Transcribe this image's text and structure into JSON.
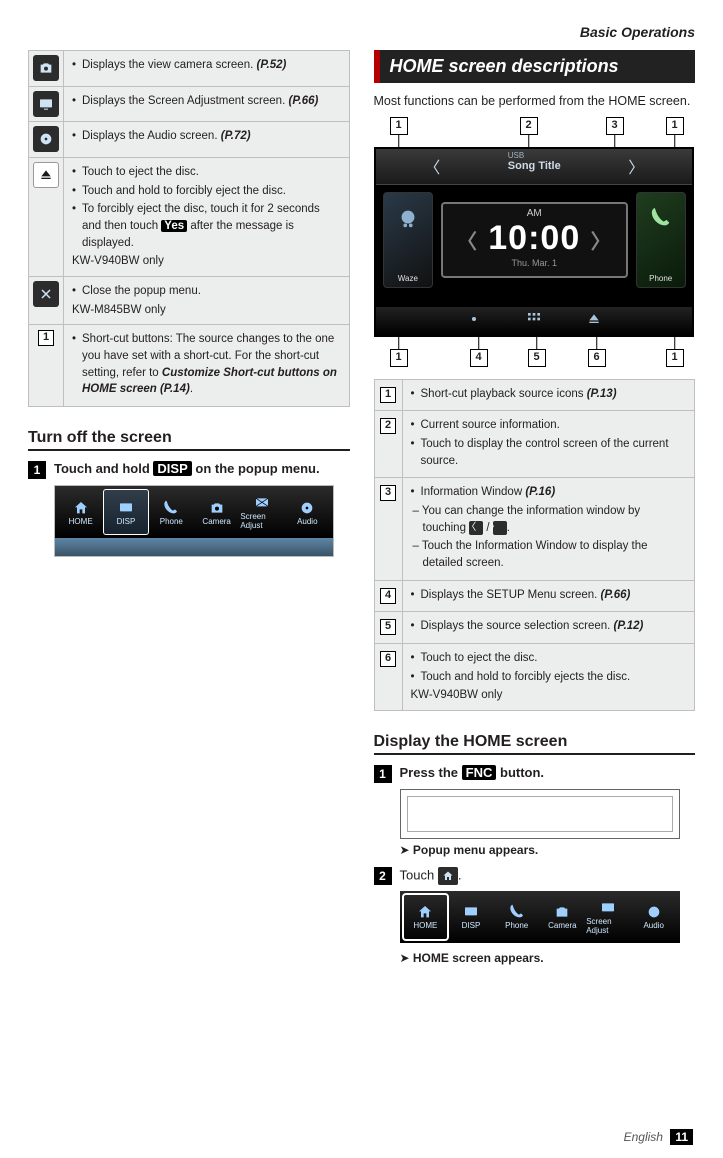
{
  "runningHeader": "Basic Operations",
  "leftTable": {
    "rows": [
      {
        "iconName": "camera-icon",
        "text": "Displays the view camera screen.",
        "ref": "(P.52)"
      },
      {
        "iconName": "screen-adjust-icon",
        "text": "Displays the Screen Adjustment screen.",
        "ref": "(P.66)"
      },
      {
        "iconName": "audio-icon",
        "text": "Displays the Audio screen.",
        "ref": "(P.72)"
      },
      {
        "iconName": "eject-icon",
        "bullets": [
          "Touch to eject the disc.",
          "Touch and hold to forcibly eject the disc.",
          "To forcibly eject the disc, touch it for 2 seconds and then touch "
        ],
        "yesLabel": "Yes",
        "bullet3_tail": " after the message is displayed.",
        "note": "KW-V940BW only"
      },
      {
        "iconName": "close-icon",
        "bullets": [
          "Close the popup menu."
        ],
        "note": "KW-M845BW only"
      },
      {
        "iconName": "one-box",
        "bullets": [
          "Short-cut buttons: The source changes to the one you have set with a short-cut. For the short-cut setting, refer to "
        ],
        "crossRef": "Customize Short-cut buttons on HOME screen (P.14)",
        "tail": "."
      }
    ]
  },
  "turnOff": {
    "heading": "Turn off the screen",
    "step1": {
      "num": "1",
      "pre": "Touch and hold ",
      "btn": "DISP",
      "post": " on the popup menu."
    }
  },
  "popupMenu": {
    "items": [
      {
        "name": "home-button",
        "label": "HOME"
      },
      {
        "name": "disp-button",
        "label": "DISP"
      },
      {
        "name": "phone-button",
        "label": "Phone"
      },
      {
        "name": "camera-button",
        "label": "Camera"
      },
      {
        "name": "screen-adjust-button",
        "label": "Screen Adjust"
      },
      {
        "name": "audio-button",
        "label": "Audio"
      }
    ],
    "highlightIndex": 1
  },
  "homeBand": "HOME screen descriptions",
  "homeIntro": "Most functions can be performed from the HOME screen.",
  "homeMock": {
    "usb": "USB",
    "song": "Song Title",
    "am": "AM",
    "time": "10:00",
    "date": "Thu. Mar.  1",
    "leftCard": "Waze",
    "rightCard": "Phone",
    "callouts": {
      "top": [
        "1",
        "2",
        "3",
        "1"
      ],
      "bottom": [
        "1",
        "4",
        "5",
        "6",
        "1"
      ]
    }
  },
  "rightTable": {
    "rows": [
      {
        "n": "1",
        "bullets": [
          "Short-cut playback source icons "
        ],
        "ref": "(P.13)"
      },
      {
        "n": "2",
        "bullets": [
          "Current source information.",
          "Touch to display the control screen of the current source."
        ]
      },
      {
        "n": "3",
        "bullets": [
          "Information Window "
        ],
        "ref": "(P.16)",
        "subs": [
          "You can change the information window by touching ",
          "Touch the Information Window to display the detailed screen."
        ]
      },
      {
        "n": "4",
        "bullets": [
          "Displays the SETUP Menu screen. "
        ],
        "ref": "(P.66)"
      },
      {
        "n": "5",
        "bullets": [
          "Displays the source selection screen. "
        ],
        "ref": "(P.12)"
      },
      {
        "n": "6",
        "bullets": [
          "Touch to eject the disc.",
          "Touch and hold to forcibly ejects the disc."
        ],
        "note": "KW-V940BW only"
      }
    ]
  },
  "displayHome": {
    "heading": "Display the HOME screen",
    "step1": {
      "num": "1",
      "pre": "Press the ",
      "btn": "FNC",
      "post": " button."
    },
    "result1": "Popup menu appears.",
    "step2": {
      "num": "2",
      "pre": "Touch ",
      "post": "."
    },
    "result2": "HOME screen appears."
  },
  "footer": {
    "lang": "English",
    "page": "11"
  }
}
